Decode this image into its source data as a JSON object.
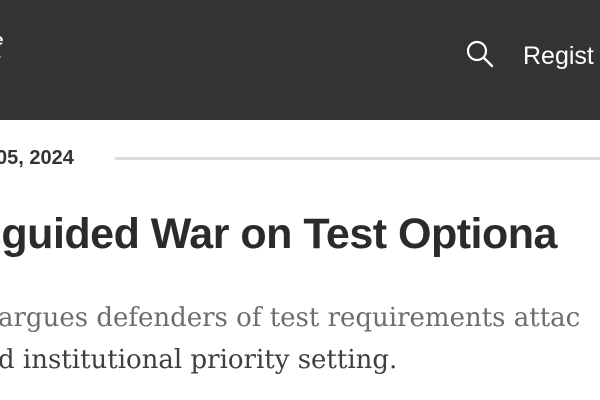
{
  "header": {
    "logo_line1": "e",
    "logo_line2": "r",
    "register_label": "Regist",
    "search_icon": "search-icon"
  },
  "article": {
    "date": "05, 2024",
    "headline": "sguided War on Test Optiona",
    "dek_line1": "argues defenders of test requirements attac",
    "dek_line2": "d institutional priority setting."
  },
  "colors": {
    "header_bg": "#333333",
    "header_text": "#ffffff",
    "headline": "#2b2b2b",
    "dek": "#6d6d6d",
    "rule": "#dddddd"
  }
}
